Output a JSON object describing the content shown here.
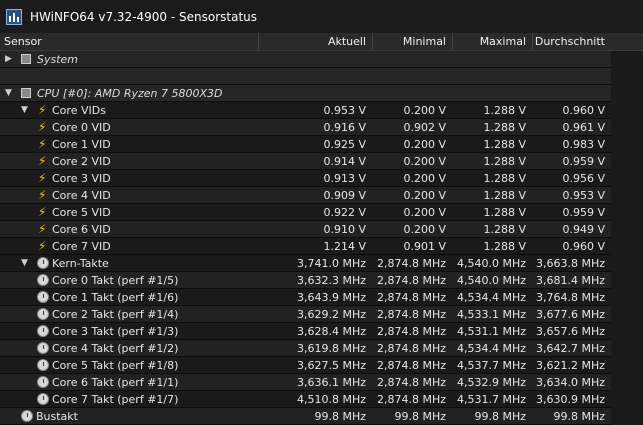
{
  "window": {
    "title": "HWiNFO64 v7.32-4900 - Sensorstatus"
  },
  "header": {
    "sensor": "Sensor",
    "current": "Aktuell",
    "min": "Minimal",
    "max": "Maximal",
    "avg": "Durchschnitt"
  },
  "groups": {
    "system": "System",
    "cpu": "CPU [#0]: AMD Ryzen 7 5800X3D"
  },
  "vid": {
    "label": "Core VIDs",
    "summary": [
      "0.953 V",
      "0.200 V",
      "1.288 V",
      "0.960 V"
    ],
    "rows": [
      {
        "label": "Core 0 VID",
        "values": [
          "0.916 V",
          "0.902 V",
          "1.288 V",
          "0.961 V"
        ]
      },
      {
        "label": "Core 1 VID",
        "values": [
          "0.925 V",
          "0.200 V",
          "1.288 V",
          "0.983 V"
        ]
      },
      {
        "label": "Core 2 VID",
        "values": [
          "0.914 V",
          "0.200 V",
          "1.288 V",
          "0.959 V"
        ]
      },
      {
        "label": "Core 3 VID",
        "values": [
          "0.913 V",
          "0.200 V",
          "1.288 V",
          "0.956 V"
        ]
      },
      {
        "label": "Core 4 VID",
        "values": [
          "0.909 V",
          "0.200 V",
          "1.288 V",
          "0.953 V"
        ]
      },
      {
        "label": "Core 5 VID",
        "values": [
          "0.922 V",
          "0.200 V",
          "1.288 V",
          "0.959 V"
        ]
      },
      {
        "label": "Core 6 VID",
        "values": [
          "0.910 V",
          "0.200 V",
          "1.288 V",
          "0.949 V"
        ]
      },
      {
        "label": "Core 7 VID",
        "values": [
          "1.214 V",
          "0.901 V",
          "1.288 V",
          "0.960 V"
        ]
      }
    ]
  },
  "clocks": {
    "label": "Kern-Takte",
    "summary": [
      "3,741.0 MHz",
      "2,874.8 MHz",
      "4,540.0 MHz",
      "3,663.8 MHz"
    ],
    "rows": [
      {
        "label": "Core 0 Takt (perf #1/5)",
        "values": [
          "3,632.3 MHz",
          "2,874.8 MHz",
          "4,540.0 MHz",
          "3,681.4 MHz"
        ]
      },
      {
        "label": "Core 1 Takt (perf #1/6)",
        "values": [
          "3,643.9 MHz",
          "2,874.8 MHz",
          "4,534.4 MHz",
          "3,764.8 MHz"
        ]
      },
      {
        "label": "Core 2 Takt (perf #1/4)",
        "values": [
          "3,629.2 MHz",
          "2,874.8 MHz",
          "4,533.1 MHz",
          "3,677.6 MHz"
        ]
      },
      {
        "label": "Core 3 Takt (perf #1/3)",
        "values": [
          "3,628.4 MHz",
          "2,874.8 MHz",
          "4,531.1 MHz",
          "3,657.6 MHz"
        ]
      },
      {
        "label": "Core 4 Takt (perf #1/2)",
        "values": [
          "3,619.8 MHz",
          "2,874.8 MHz",
          "4,534.4 MHz",
          "3,642.7 MHz"
        ]
      },
      {
        "label": "Core 5 Takt (perf #1/8)",
        "values": [
          "3,627.5 MHz",
          "2,874.8 MHz",
          "4,537.7 MHz",
          "3,621.2 MHz"
        ]
      },
      {
        "label": "Core 6 Takt (perf #1/1)",
        "values": [
          "3,636.1 MHz",
          "2,874.8 MHz",
          "4,532.9 MHz",
          "3,634.0 MHz"
        ]
      },
      {
        "label": "Core 7 Takt (perf #1/7)",
        "values": [
          "4,510.8 MHz",
          "2,874.8 MHz",
          "4,531.7 MHz",
          "3,630.9 MHz"
        ]
      }
    ]
  },
  "bus": {
    "label": "Bustakt",
    "values": [
      "99.8 MHz",
      "99.8 MHz",
      "99.8 MHz",
      "99.8 MHz"
    ]
  },
  "icons": {
    "app": "hwinfo-app-icon",
    "voltage": "lightning-bolt-icon",
    "clock": "clock-icon",
    "chip": "chip-icon"
  },
  "colors": {
    "background": "#1a1a1a",
    "bolt": "#f2c21a",
    "text": "#e6e6e6"
  }
}
